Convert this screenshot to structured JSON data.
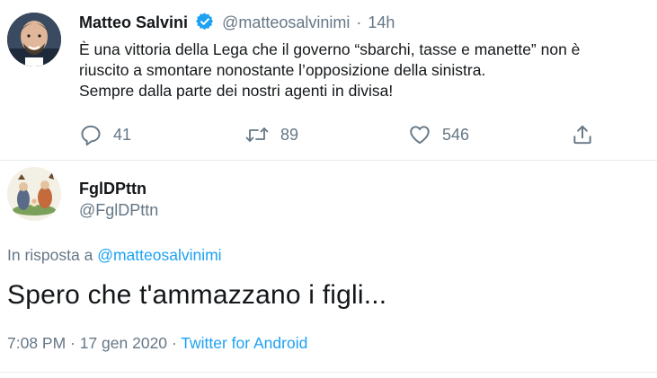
{
  "original_tweet": {
    "author_name": "Matteo Salvini",
    "author_handle": "@matteosalvinimi",
    "separator": "·",
    "time": "14h",
    "text_lines": [
      "È una vittoria della Lega che il governo “sbarchi, tasse e manette” non è",
      "riuscito a smontare nonostante l’opposizione della sinistra.",
      "Sempre dalla parte dei nostri agenti in divisa!"
    ],
    "actions": {
      "replies": "41",
      "retweets": "89",
      "likes": "546"
    },
    "icons": [
      "verified-badge-icon",
      "reply-icon",
      "retweet-icon",
      "like-icon",
      "share-icon"
    ]
  },
  "reply_tweet": {
    "author_name": "FglDPttn",
    "author_handle": "@FglDPttn",
    "reply_prefix": "In risposta a",
    "reply_mention": "@matteosalvinimi",
    "text": "Spero che t'ammazzano i figli...",
    "timestamp": "7:08 PM · 17 gen 2020 ·",
    "source": "Twitter for Android"
  },
  "colors": {
    "text_primary": "#14171a",
    "text_secondary": "#657786",
    "accent": "#1da1f2",
    "divider": "#e6ecf0"
  }
}
